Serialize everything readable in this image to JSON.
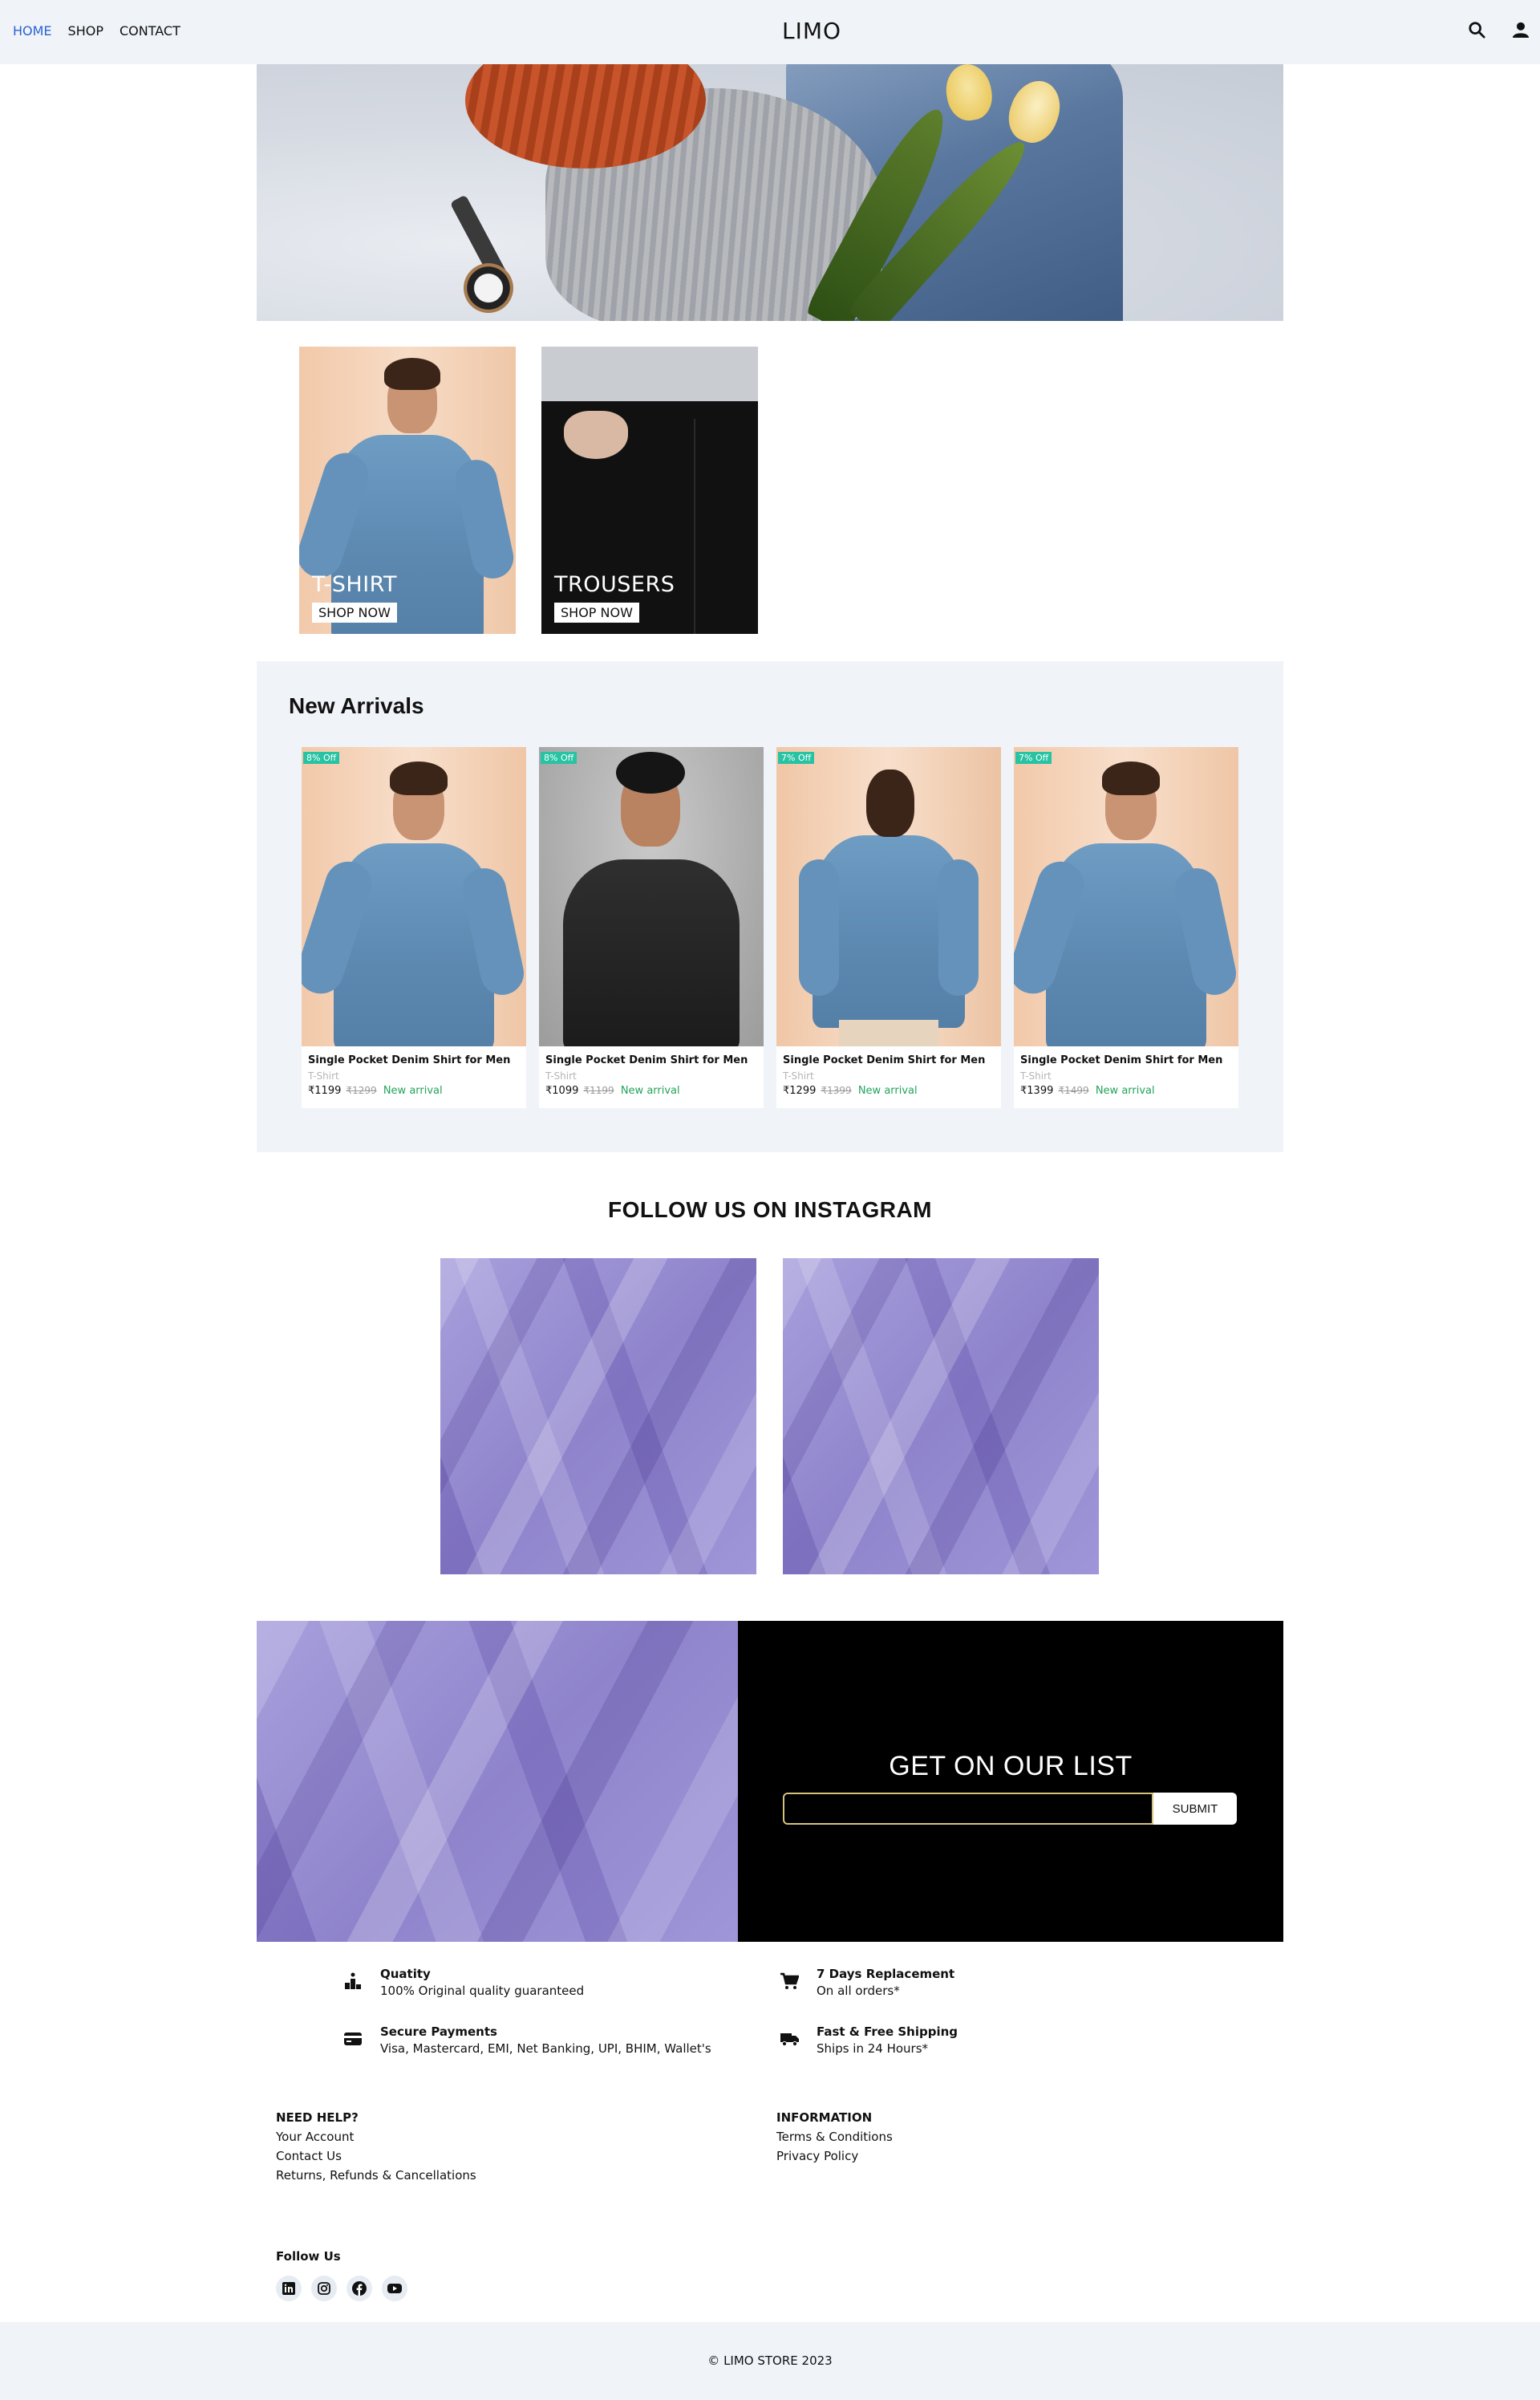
{
  "nav": {
    "links": [
      "HOME",
      "SHOP",
      "CONTACT"
    ],
    "active": "HOME",
    "logo": "LIMO",
    "icons": [
      "search-icon",
      "user-icon"
    ],
    "accent_color": "#2a63d4"
  },
  "categories": [
    {
      "title": "T-SHIRT",
      "button": "SHOP NOW"
    },
    {
      "title": "TROUSERS",
      "button": "SHOP NOW"
    }
  ],
  "new_arrivals": {
    "heading": "New Arrivals",
    "badge_color": "#27c3a3",
    "products": [
      {
        "badge": "8% Off",
        "name": "Single Pocket Denim Shirt for Men",
        "category": "T-Shirt",
        "price": "₹1199",
        "old_price": "₹1299",
        "tag": "New arrival"
      },
      {
        "badge": "8% Off",
        "name": "Single Pocket Denim Shirt for Men",
        "category": "T-Shirt",
        "price": "₹1099",
        "old_price": "₹1199",
        "tag": "New arrival"
      },
      {
        "badge": "7% Off",
        "name": "Single Pocket Denim Shirt for Men",
        "category": "T-Shirt",
        "price": "₹1299",
        "old_price": "₹1399",
        "tag": "New arrival"
      },
      {
        "badge": "7% Off",
        "name": "Single Pocket Denim Shirt for Men",
        "category": "T-Shirt",
        "price": "₹1399",
        "old_price": "₹1499",
        "tag": "New arrival"
      }
    ]
  },
  "instagram": {
    "heading": "FOLLOW US ON INSTAGRAM"
  },
  "newsletter": {
    "heading": "GET ON OUR LIST",
    "input_value": "",
    "submit": "SUBMIT"
  },
  "features": [
    {
      "icon": "quality-icon",
      "title": "Quatity",
      "text": "100% Original quality guaranteed"
    },
    {
      "icon": "cart-icon",
      "title": "7 Days Replacement",
      "text": "On all orders*"
    },
    {
      "icon": "credit-card-icon",
      "title": "Secure Payments",
      "text": "Visa, Mastercard, EMI, Net Banking, UPI, BHIM, Wallet's"
    },
    {
      "icon": "truck-icon",
      "title": "Fast & Free Shipping",
      "text": "Ships in 24 Hours*"
    }
  ],
  "footer": {
    "help": {
      "heading": "NEED HELP?",
      "links": [
        "Your Account",
        "Contact Us",
        "Returns, Refunds & Cancellations"
      ]
    },
    "info": {
      "heading": "INFORMATION",
      "links": [
        "Terms & Conditions",
        "Privacy Policy"
      ]
    },
    "follow_heading": "Follow Us",
    "socials": [
      "linkedin-icon",
      "instagram-icon",
      "facebook-icon",
      "youtube-icon"
    ],
    "copyright": "© LIMO STORE 2023"
  }
}
